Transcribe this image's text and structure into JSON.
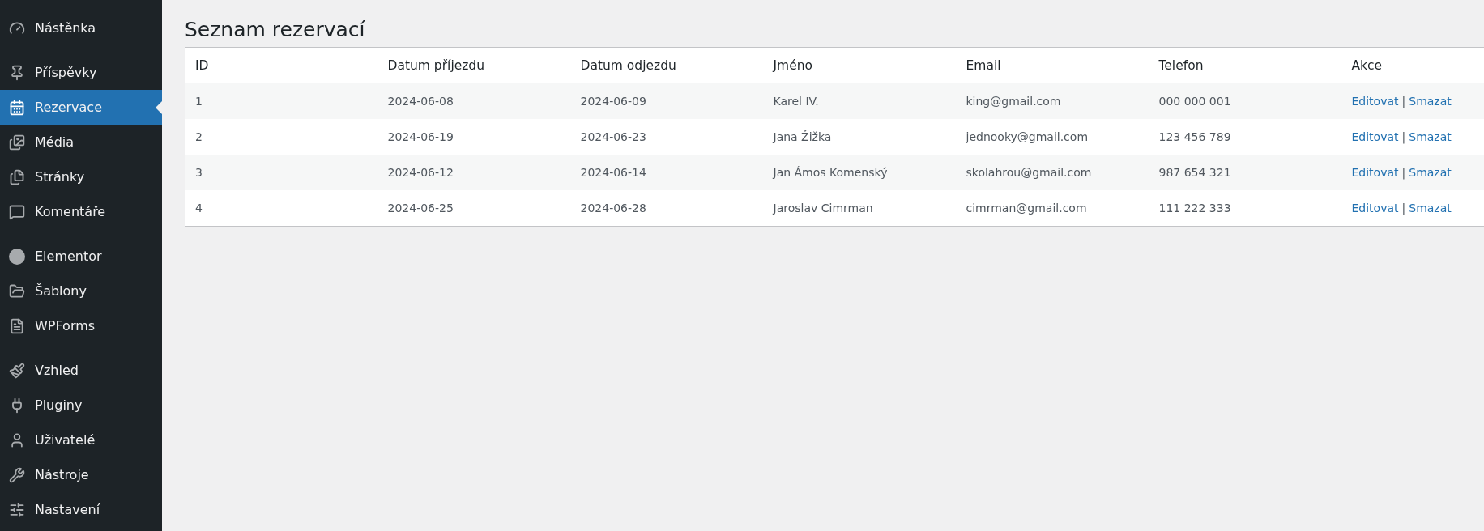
{
  "sidebar": {
    "groups": [
      {
        "items": [
          {
            "label": "Nástěnka",
            "selected": false
          }
        ]
      },
      {
        "items": [
          {
            "label": "Příspěvky",
            "selected": false
          },
          {
            "label": "Rezervace",
            "selected": true
          },
          {
            "label": "Média",
            "selected": false
          },
          {
            "label": "Stránky",
            "selected": false
          },
          {
            "label": "Komentáře",
            "selected": false
          }
        ]
      },
      {
        "items": [
          {
            "label": "Elementor",
            "selected": false
          },
          {
            "label": "Šablony",
            "selected": false
          },
          {
            "label": "WPForms",
            "selected": false
          }
        ]
      },
      {
        "items": [
          {
            "label": "Vzhled",
            "selected": false
          },
          {
            "label": "Pluginy",
            "selected": false
          },
          {
            "label": "Uživatelé",
            "selected": false
          },
          {
            "label": "Nástroje",
            "selected": false
          },
          {
            "label": "Nastavení",
            "selected": false
          }
        ]
      }
    ]
  },
  "page": {
    "title": "Seznam rezervací"
  },
  "table": {
    "columns": [
      "ID",
      "Datum příjezdu",
      "Datum odjezdu",
      "Jméno",
      "Email",
      "Telefon",
      "Akce"
    ],
    "rows": [
      {
        "cells": [
          "1",
          "2024-06-08",
          "2024-06-09",
          "Karel IV.",
          "king@gmail.com",
          "000 000 001"
        ],
        "actions": {
          "edit": "Editovat",
          "separator": "|",
          "delete": "Smazat"
        }
      },
      {
        "cells": [
          "2",
          "2024-06-19",
          "2024-06-23",
          "Jana Žižka",
          "jednooky@gmail.com",
          "123 456 789"
        ],
        "actions": {
          "edit": "Editovat",
          "separator": "|",
          "delete": "Smazat"
        }
      },
      {
        "cells": [
          "3",
          "2024-06-12",
          "2024-06-14",
          "Jan Ámos Komenský",
          "skolahrou@gmail.com",
          "987 654 321"
        ],
        "actions": {
          "edit": "Editovat",
          "separator": "|",
          "delete": "Smazat"
        }
      },
      {
        "cells": [
          "4",
          "2024-06-25",
          "2024-06-28",
          "Jaroslav Cimrman",
          "cimrman@gmail.com",
          "111 222 333"
        ],
        "actions": {
          "edit": "Editovat",
          "separator": "|",
          "delete": "Smazat"
        }
      }
    ]
  }
}
